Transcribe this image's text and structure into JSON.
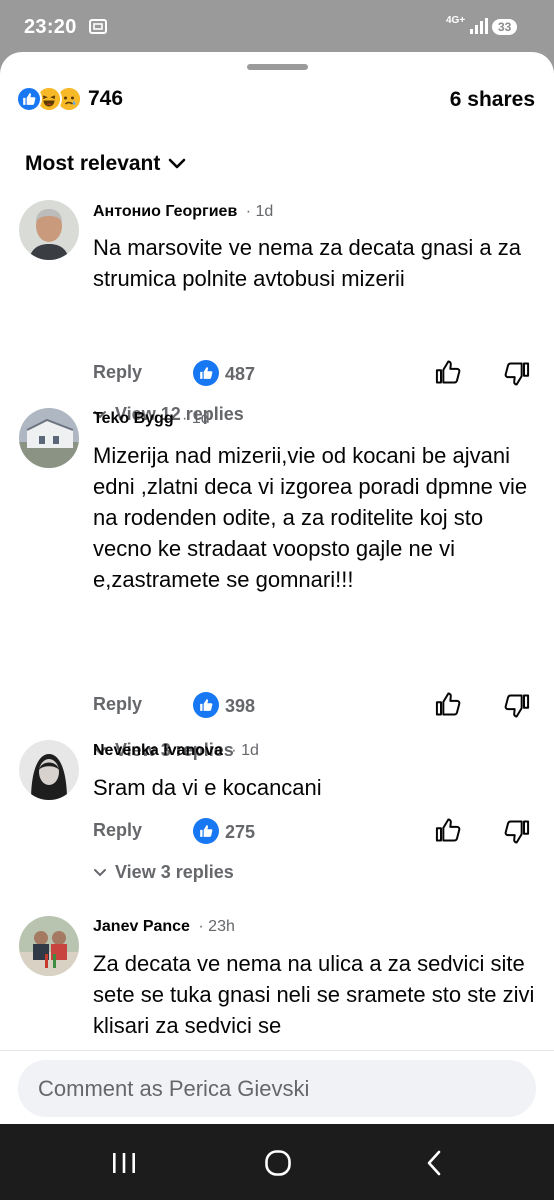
{
  "status_bar": {
    "time": "23:20",
    "network": "4G+",
    "battery": "33"
  },
  "post_summary": {
    "reaction_count": "746",
    "shares": "6 shares"
  },
  "sort": {
    "label": "Most relevant"
  },
  "comments": [
    {
      "author": "Антонио Георгиев",
      "time": "1d",
      "text": "Na marsovite ve nema za decata gnasi a za strumica polnite avtobusi mizerii",
      "reply_label": "Reply",
      "likes": "487",
      "view_replies": "View 12 replies"
    },
    {
      "author": "Teko Bygg",
      "time": "1d",
      "text": "Mizerija nad mizerii,vie od kocani be ajvani edni ,zlatni deca vi izgorea poradi dpmne vie na rodenden odite, a za roditelite koj sto vecno ke stradaat voopsto gajle ne vi e,zastramete se gomnari!!!",
      "reply_label": "Reply",
      "likes": "398",
      "view_replies": "View 3 replies"
    },
    {
      "author": "Nevenka Ivanova",
      "time": "1d",
      "text": "Sram da vi e kocancani",
      "reply_label": "Reply",
      "likes": "275",
      "view_replies": "View 3 replies"
    },
    {
      "author": "Janev Pance",
      "time": "23h",
      "text": "Za decata ve nema na ulica a za sedvici site sete se tuka gnasi neli se sramete sto ste zivi klisari za sedvici se"
    }
  ],
  "composer": {
    "placeholder": "Comment as Perica Gievski"
  },
  "icons": {
    "like": "like-icon",
    "haha": "haha-icon",
    "sad": "sad-icon",
    "thumb_up": "thumb-up-icon",
    "thumb_down": "thumb-down-icon",
    "chevron": "chevron-down-icon",
    "nav_recents": "recents-icon",
    "nav_home": "home-icon",
    "nav_back": "back-icon"
  },
  "colors": {
    "facebook_blue": "#1877f2",
    "secondary_text": "#65676b",
    "primary_text": "#050505"
  }
}
